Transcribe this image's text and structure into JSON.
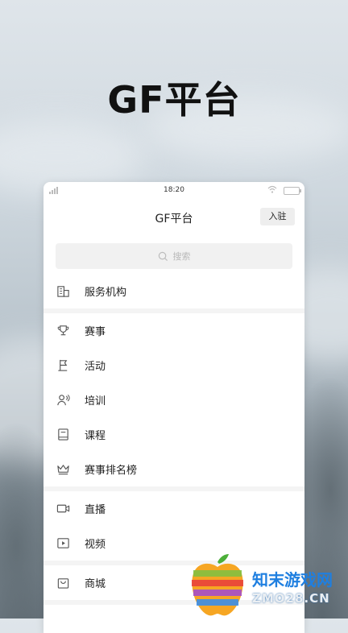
{
  "hero": {
    "title": "GF平台"
  },
  "status_bar": {
    "time": "18:20"
  },
  "navbar": {
    "title": "GF平台",
    "join_label": "入驻"
  },
  "search": {
    "placeholder": "搜索"
  },
  "menu_groups": [
    [
      {
        "label": "服务机构",
        "icon": "building-icon"
      }
    ],
    [
      {
        "label": "赛事",
        "icon": "trophy-icon"
      },
      {
        "label": "活动",
        "icon": "flag-icon"
      },
      {
        "label": "培训",
        "icon": "trainer-icon"
      },
      {
        "label": "课程",
        "icon": "book-icon"
      },
      {
        "label": "赛事排名榜",
        "icon": "crown-icon"
      }
    ],
    [
      {
        "label": "直播",
        "icon": "video-camera-icon"
      },
      {
        "label": "视频",
        "icon": "play-icon"
      }
    ],
    [
      {
        "label": "商城",
        "icon": "shopping-bag-icon"
      }
    ]
  ],
  "watermark": {
    "name": "知末游戏网",
    "url": "ZMO28.CN"
  },
  "colors": {
    "watermark_blue": "#1f7fe0"
  }
}
